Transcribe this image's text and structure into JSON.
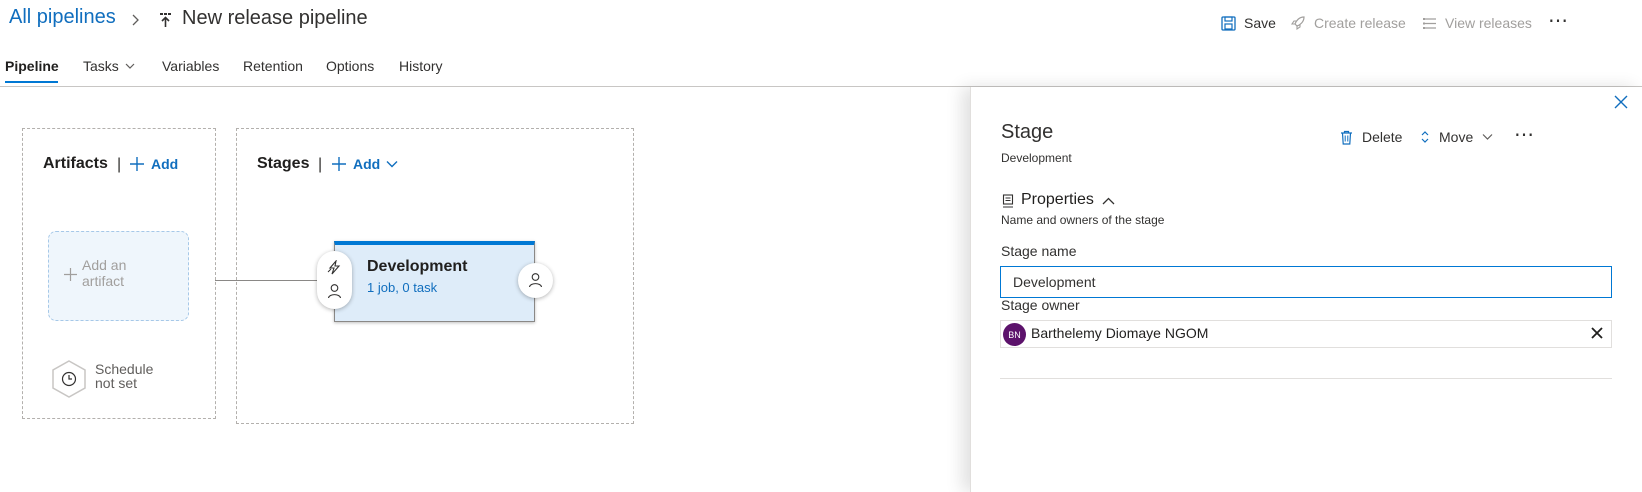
{
  "breadcrumb": {
    "root": "All pipelines",
    "separator_icon": "chevron-right-icon",
    "pipeline_icon": "release-pipeline-icon"
  },
  "page": {
    "title": "New release pipeline"
  },
  "toolbar": {
    "save_label": "Save",
    "create_release_label": "Create release",
    "view_releases_label": "View releases",
    "more_label": "⋯"
  },
  "tabs": [
    {
      "label": "Pipeline",
      "active": true
    },
    {
      "label": "Tasks",
      "has_dropdown": true
    },
    {
      "label": "Variables"
    },
    {
      "label": "Retention"
    },
    {
      "label": "Options"
    },
    {
      "label": "History"
    }
  ],
  "artifacts": {
    "title": "Artifacts",
    "separator": "|",
    "add_label": "Add",
    "placeholder_line1": "Add an",
    "placeholder_line2": "artifact",
    "schedule_line1": "Schedule",
    "schedule_line2": "not set"
  },
  "stages": {
    "title": "Stages",
    "separator": "|",
    "add_label": "Add",
    "items": [
      {
        "name": "Development",
        "summary": "1 job, 0 task"
      }
    ]
  },
  "panel": {
    "heading": "Stage",
    "subheading": "Development",
    "actions": {
      "delete_label": "Delete",
      "move_label": "Move",
      "more_label": "⋯"
    },
    "properties": {
      "title": "Properties",
      "description": "Name and owners of the stage"
    },
    "fields": {
      "stage_name_label": "Stage name",
      "stage_name_value": "Development",
      "stage_owner_label": "Stage owner",
      "owner": {
        "initials": "BN",
        "name": "Barthelemy Diomaye NGOM"
      }
    }
  },
  "colors": {
    "accent": "#0078d4",
    "link": "#106ebe",
    "stage_fill": "#deecf9",
    "avatar": "#5c126b",
    "disabled_text": "#a19f9d"
  }
}
